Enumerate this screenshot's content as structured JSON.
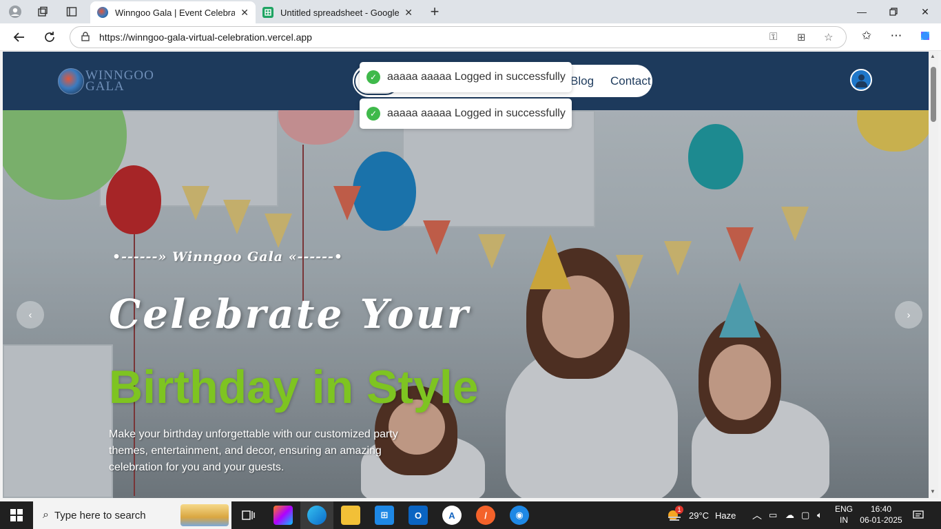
{
  "browser": {
    "tabs": [
      {
        "title": "Winngoo Gala | Event Celebration",
        "active": true,
        "favicon": "site-globe-icon"
      },
      {
        "title": "Untitled spreadsheet - Google Sh",
        "active": false,
        "favicon": "google-sheets-icon"
      }
    ],
    "new_tab_label": "+",
    "url": "https://winngoo-gala-virtual-celebration.vercel.app"
  },
  "site": {
    "logo_line1": "WINNGOO",
    "logo_line2": "GALA",
    "nav": {
      "blog": "Blog",
      "contact": "Contact"
    },
    "toasts": [
      {
        "message": "aaaaa aaaaa Logged in successfully"
      },
      {
        "message": "aaaaa aaaaa Logged in successfully"
      }
    ],
    "hero": {
      "tagline": "•------» Winngoo Gala «------•",
      "heading_line1": "Celebrate Your",
      "heading_line2": "Birthday in Style",
      "description": "Make your birthday unforgettable with our customized party themes, entertainment, and decor, ensuring an amazing celebration for you and your guests.",
      "prev_label": "‹",
      "next_label": "›"
    },
    "colors": {
      "header_bg": "#1d3a5c",
      "accent_green": "#7ec421",
      "toast_check": "#3fb94b"
    }
  },
  "taskbar": {
    "search_placeholder": "Type here to search",
    "weather_temp": "29°C",
    "weather_desc": "Haze",
    "weather_badge": "1",
    "language_top": "ENG",
    "language_bottom": "IN",
    "time": "16:40",
    "date": "06-01-2025"
  }
}
